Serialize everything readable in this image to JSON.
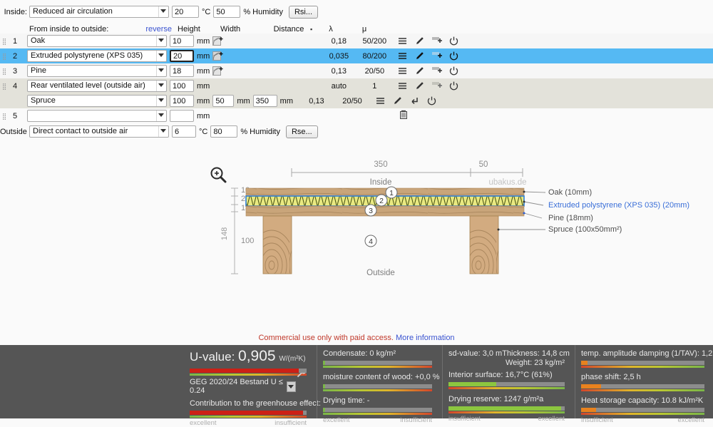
{
  "builder": {
    "inside_label": "Inside:",
    "inside_condition": "Reduced air circulation",
    "inside_temp": "20",
    "temp_unit": "°C",
    "inside_humidity": "50",
    "humidity_unit": "% Humidity",
    "rsi_button": "Rsi...",
    "headers": {
      "order": "From inside to outside:",
      "reverse": "reverse",
      "height": "Height",
      "width": "Width",
      "distance": "Distance",
      "lambda": "λ",
      "mu": "μ"
    },
    "mm": "mm",
    "layers": [
      {
        "num": "1",
        "material": "Oak",
        "height": "10",
        "lambda": "0,18",
        "mu": "50/200"
      },
      {
        "num": "2",
        "material": "Extruded polystyrene (XPS 035)",
        "height": "20",
        "lambda": "0,035",
        "mu": "80/200"
      },
      {
        "num": "3",
        "material": "Pine",
        "height": "18",
        "lambda": "0,13",
        "mu": "20/50"
      },
      {
        "num": "4",
        "material": "Rear ventilated level (outside air)",
        "height": "100",
        "lambda": "auto",
        "mu": "1"
      },
      {
        "num": "",
        "material": "Spruce",
        "height": "100",
        "width": "50",
        "distance": "350",
        "lambda": "0,13",
        "mu": "20/50"
      },
      {
        "num": "5",
        "material": "",
        "height": "",
        "lambda": "",
        "mu": ""
      }
    ],
    "outside_label": "Outside",
    "outside_condition": "Direct contact to outside air",
    "outside_temp": "6",
    "outside_humidity": "80",
    "rse_button": "Rse..."
  },
  "diagram": {
    "inside_label": "Inside",
    "outside_label": "Outside",
    "watermark": "ubakus.de",
    "dim_top_350": "350",
    "dim_top_50": "50",
    "dim_left": [
      "10",
      "20",
      "18",
      "100"
    ],
    "dim_total": "148",
    "callouts": [
      "1",
      "2",
      "3",
      "4"
    ],
    "legend": [
      {
        "text": "Oak (10mm)",
        "color": "#4d4d4d"
      },
      {
        "text": "Extruded polystyrene (XPS 035) (20mm)",
        "color": "#3a6fd8"
      },
      {
        "text": "Pine (18mm)",
        "color": "#4d4d4d"
      },
      {
        "text": "Spruce (100x50mm²)",
        "color": "#4d4d4d"
      }
    ]
  },
  "notice": {
    "text": "Commercial use only with paid access. ",
    "link": "More information"
  },
  "results": {
    "uvalue": {
      "label": "U-value:",
      "value": "0,905",
      "unit": "W/(m²K)",
      "bar_percent": 93,
      "standard": "GEG 2020/24 Bestand U ≤ 0.24",
      "greenhouse_label": "Contribution to the greenhouse effect:",
      "greenhouse_percent": 97,
      "scale_left": "excellent",
      "scale_right": "insufficient"
    },
    "moisture": {
      "condensate": "Condensate: 0 kg/m²",
      "condensate_percent": 2,
      "wood_moisture": "moisture content of wood: +0,0 %",
      "wood_percent": 2,
      "drying_time": "Drying time: -",
      "drying_percent": 2,
      "scale_left": "excellent",
      "scale_right": "insufficient"
    },
    "misc": {
      "sd_value": "sd-value: 3,0 m",
      "thickness": "Thickness: 14,8 cm",
      "weight": "Weight: 23 kg/m²",
      "interior_surface": "Interior surface: 16,7°C (61%)",
      "interior_percent": 41,
      "drying_reserve": "Drying reserve: 1247 g/m²a",
      "drying_reserve_percent": 97,
      "scale_left": "insufficient",
      "scale_right": "excellent"
    },
    "thermal": {
      "damping": "temp. amplitude damping (1/TAV): 1,2",
      "damping_percent": 5,
      "phase_shift": "phase shift: 2,5 h",
      "phase_percent": 16,
      "heat_storage": "Heat storage capacity: 10.8 kJ/m²K",
      "heat_percent": 12,
      "scale_left": "insufficient",
      "scale_right": "excellent"
    }
  }
}
